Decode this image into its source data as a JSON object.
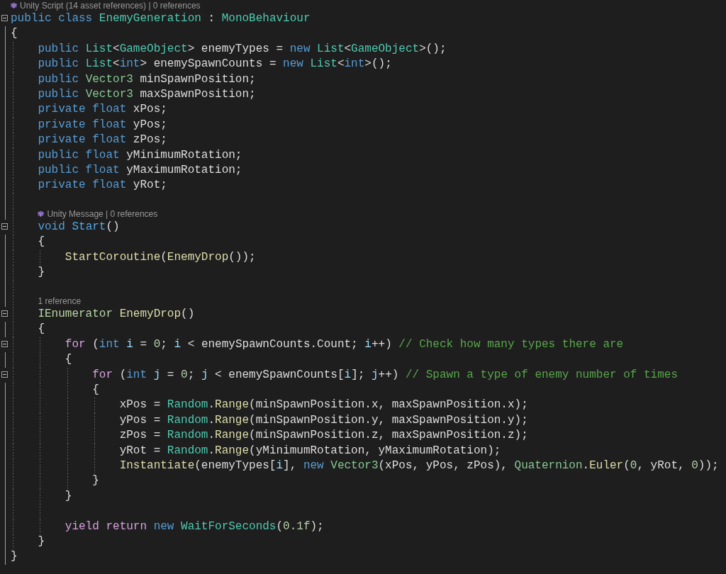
{
  "lines": [
    {
      "kind": "lens",
      "icon": true,
      "text": "Unity Script (14 asset references) | 0 references"
    },
    {
      "kind": "code",
      "fold": true,
      "tokens": [
        {
          "kind": "keyword",
          "text": "public class "
        },
        {
          "kind": "class",
          "text": "EnemyGeneration"
        },
        {
          "kind": "plain",
          "text": " : "
        },
        {
          "kind": "class",
          "text": "MonoBehaviour"
        }
      ]
    },
    {
      "kind": "code",
      "fold": false,
      "tokens": [
        {
          "kind": "plain",
          "text": "{"
        }
      ],
      "children": [
        {
          "kind": "code",
          "fold": false,
          "tokens": [
            {
              "kind": "keyword",
              "text": "public "
            },
            {
              "kind": "class",
              "text": "List"
            },
            {
              "kind": "plain",
              "text": "<"
            },
            {
              "kind": "class",
              "text": "GameObject"
            },
            {
              "kind": "plain",
              "text": "> enemyTypes = "
            },
            {
              "kind": "keyword",
              "text": "new "
            },
            {
              "kind": "class",
              "text": "List"
            },
            {
              "kind": "plain",
              "text": "<"
            },
            {
              "kind": "class",
              "text": "GameObject"
            },
            {
              "kind": "plain",
              "text": ">();"
            }
          ]
        },
        {
          "kind": "code",
          "fold": false,
          "tokens": [
            {
              "kind": "keyword",
              "text": "public "
            },
            {
              "kind": "class",
              "text": "List"
            },
            {
              "kind": "plain",
              "text": "<"
            },
            {
              "kind": "keyword",
              "text": "int"
            },
            {
              "kind": "plain",
              "text": "> enemySpawnCounts = "
            },
            {
              "kind": "keyword",
              "text": "new "
            },
            {
              "kind": "class",
              "text": "List"
            },
            {
              "kind": "plain",
              "text": "<"
            },
            {
              "kind": "keyword",
              "text": "int"
            },
            {
              "kind": "plain",
              "text": ">();"
            }
          ]
        },
        {
          "kind": "code",
          "fold": false,
          "tokens": [
            {
              "kind": "keyword",
              "text": "public "
            },
            {
              "kind": "struct",
              "text": "Vector3"
            },
            {
              "kind": "plain",
              "text": " minSpawnPosition;"
            }
          ]
        },
        {
          "kind": "code",
          "fold": false,
          "tokens": [
            {
              "kind": "keyword",
              "text": "public "
            },
            {
              "kind": "struct",
              "text": "Vector3"
            },
            {
              "kind": "plain",
              "text": " maxSpawnPosition;"
            }
          ]
        },
        {
          "kind": "code",
          "fold": false,
          "tokens": [
            {
              "kind": "keyword",
              "text": "private float "
            },
            {
              "kind": "plain",
              "text": "xPos;"
            }
          ]
        },
        {
          "kind": "code",
          "fold": false,
          "tokens": [
            {
              "kind": "keyword",
              "text": "private float "
            },
            {
              "kind": "plain",
              "text": "yPos;"
            }
          ]
        },
        {
          "kind": "code",
          "fold": false,
          "tokens": [
            {
              "kind": "keyword",
              "text": "private float "
            },
            {
              "kind": "plain",
              "text": "zPos;"
            }
          ]
        },
        {
          "kind": "code",
          "fold": false,
          "tokens": [
            {
              "kind": "keyword",
              "text": "public float "
            },
            {
              "kind": "plain",
              "text": "yMinimumRotation;"
            }
          ]
        },
        {
          "kind": "code",
          "fold": false,
          "tokens": [
            {
              "kind": "keyword",
              "text": "public float "
            },
            {
              "kind": "plain",
              "text": "yMaximumRotation;"
            }
          ]
        },
        {
          "kind": "code",
          "fold": false,
          "tokens": [
            {
              "kind": "keyword",
              "text": "private float "
            },
            {
              "kind": "plain",
              "text": "yRot;"
            }
          ]
        },
        {
          "kind": "blank"
        },
        {
          "kind": "lens",
          "icon": true,
          "text": "Unity Message | 0 references"
        },
        {
          "kind": "code",
          "fold": true,
          "tokens": [
            {
              "kind": "keyword",
              "text": "void "
            },
            {
              "kind": "message",
              "text": "Start"
            },
            {
              "kind": "plain",
              "text": "()"
            }
          ]
        },
        {
          "kind": "code",
          "fold": false,
          "tokens": [
            {
              "kind": "plain",
              "text": "{"
            }
          ],
          "children": [
            {
              "kind": "code",
              "fold": false,
              "tokens": [
                {
                  "kind": "method",
                  "text": "StartCoroutine"
                },
                {
                  "kind": "plain",
                  "text": "("
                },
                {
                  "kind": "method",
                  "text": "EnemyDrop"
                },
                {
                  "kind": "plain",
                  "text": "());"
                }
              ]
            }
          ]
        },
        {
          "kind": "code",
          "fold": false,
          "tokens": [
            {
              "kind": "plain",
              "text": "}"
            }
          ]
        },
        {
          "kind": "blank"
        },
        {
          "kind": "lens",
          "icon": false,
          "text": "1 reference"
        },
        {
          "kind": "code",
          "fold": true,
          "tokens": [
            {
              "kind": "interface",
              "text": "IEnumerator "
            },
            {
              "kind": "method",
              "text": "EnemyDrop"
            },
            {
              "kind": "plain",
              "text": "()"
            }
          ]
        },
        {
          "kind": "code",
          "fold": false,
          "tokens": [
            {
              "kind": "plain",
              "text": "{"
            }
          ],
          "children": [
            {
              "kind": "code",
              "fold": true,
              "tokens": [
                {
                  "kind": "control",
                  "text": "for"
                },
                {
                  "kind": "plain",
                  "text": " ("
                },
                {
                  "kind": "keyword",
                  "text": "int "
                },
                {
                  "kind": "local",
                  "text": "i"
                },
                {
                  "kind": "plain",
                  "text": " = "
                },
                {
                  "kind": "number",
                  "text": "0"
                },
                {
                  "kind": "plain",
                  "text": "; "
                },
                {
                  "kind": "local",
                  "text": "i"
                },
                {
                  "kind": "plain",
                  "text": " < enemySpawnCounts.Count; "
                },
                {
                  "kind": "local",
                  "text": "i"
                },
                {
                  "kind": "plain",
                  "text": "++) "
                },
                {
                  "kind": "comment",
                  "text": "// Check how many types there are"
                }
              ]
            },
            {
              "kind": "code",
              "fold": false,
              "tokens": [
                {
                  "kind": "plain",
                  "text": "{"
                }
              ],
              "children": [
                {
                  "kind": "code",
                  "fold": true,
                  "tokens": [
                    {
                      "kind": "control",
                      "text": "for"
                    },
                    {
                      "kind": "plain",
                      "text": " ("
                    },
                    {
                      "kind": "keyword",
                      "text": "int "
                    },
                    {
                      "kind": "local",
                      "text": "j"
                    },
                    {
                      "kind": "plain",
                      "text": " = "
                    },
                    {
                      "kind": "number",
                      "text": "0"
                    },
                    {
                      "kind": "plain",
                      "text": "; "
                    },
                    {
                      "kind": "local",
                      "text": "j"
                    },
                    {
                      "kind": "plain",
                      "text": " < enemySpawnCounts["
                    },
                    {
                      "kind": "local",
                      "text": "i"
                    },
                    {
                      "kind": "plain",
                      "text": "]; "
                    },
                    {
                      "kind": "local",
                      "text": "j"
                    },
                    {
                      "kind": "plain",
                      "text": "++) "
                    },
                    {
                      "kind": "comment",
                      "text": "// Spawn a type of enemy number of times"
                    }
                  ]
                },
                {
                  "kind": "code",
                  "fold": false,
                  "tokens": [
                    {
                      "kind": "plain",
                      "text": "{"
                    }
                  ],
                  "children": [
                    {
                      "kind": "code",
                      "fold": false,
                      "tokens": [
                        {
                          "kind": "plain",
                          "text": "xPos = "
                        },
                        {
                          "kind": "class",
                          "text": "Random"
                        },
                        {
                          "kind": "plain",
                          "text": "."
                        },
                        {
                          "kind": "method",
                          "text": "Range"
                        },
                        {
                          "kind": "plain",
                          "text": "(minSpawnPosition.x, maxSpawnPosition.x);"
                        }
                      ]
                    },
                    {
                      "kind": "code",
                      "fold": false,
                      "tokens": [
                        {
                          "kind": "plain",
                          "text": "yPos = "
                        },
                        {
                          "kind": "class",
                          "text": "Random"
                        },
                        {
                          "kind": "plain",
                          "text": "."
                        },
                        {
                          "kind": "method",
                          "text": "Range"
                        },
                        {
                          "kind": "plain",
                          "text": "(minSpawnPosition.y, maxSpawnPosition.y);"
                        }
                      ]
                    },
                    {
                      "kind": "code",
                      "fold": false,
                      "tokens": [
                        {
                          "kind": "plain",
                          "text": "zPos = "
                        },
                        {
                          "kind": "class",
                          "text": "Random"
                        },
                        {
                          "kind": "plain",
                          "text": "."
                        },
                        {
                          "kind": "method",
                          "text": "Range"
                        },
                        {
                          "kind": "plain",
                          "text": "(minSpawnPosition.z, maxSpawnPosition.z);"
                        }
                      ]
                    },
                    {
                      "kind": "code",
                      "fold": false,
                      "tokens": [
                        {
                          "kind": "plain",
                          "text": "yRot = "
                        },
                        {
                          "kind": "class",
                          "text": "Random"
                        },
                        {
                          "kind": "plain",
                          "text": "."
                        },
                        {
                          "kind": "method",
                          "text": "Range"
                        },
                        {
                          "kind": "plain",
                          "text": "(yMinimumRotation, yMaximumRotation);"
                        }
                      ]
                    },
                    {
                      "kind": "code",
                      "fold": false,
                      "tokens": [
                        {
                          "kind": "method",
                          "text": "Instantiate"
                        },
                        {
                          "kind": "plain",
                          "text": "(enemyTypes["
                        },
                        {
                          "kind": "local",
                          "text": "i"
                        },
                        {
                          "kind": "plain",
                          "text": "], "
                        },
                        {
                          "kind": "keyword",
                          "text": "new "
                        },
                        {
                          "kind": "struct",
                          "text": "Vector3"
                        },
                        {
                          "kind": "plain",
                          "text": "(xPos, yPos, zPos), "
                        },
                        {
                          "kind": "struct",
                          "text": "Quaternion"
                        },
                        {
                          "kind": "plain",
                          "text": "."
                        },
                        {
                          "kind": "method",
                          "text": "Euler"
                        },
                        {
                          "kind": "plain",
                          "text": "("
                        },
                        {
                          "kind": "number",
                          "text": "0"
                        },
                        {
                          "kind": "plain",
                          "text": ", yRot, "
                        },
                        {
                          "kind": "number",
                          "text": "0"
                        },
                        {
                          "kind": "plain",
                          "text": "));"
                        }
                      ]
                    }
                  ]
                },
                {
                  "kind": "code",
                  "fold": false,
                  "tokens": [
                    {
                      "kind": "plain",
                      "text": "}"
                    }
                  ]
                }
              ]
            },
            {
              "kind": "code",
              "fold": false,
              "tokens": [
                {
                  "kind": "plain",
                  "text": "}"
                }
              ]
            },
            {
              "kind": "blank"
            },
            {
              "kind": "code",
              "fold": false,
              "tokens": [
                {
                  "kind": "control",
                  "text": "yield return "
                },
                {
                  "kind": "keyword",
                  "text": "new "
                },
                {
                  "kind": "class",
                  "text": "WaitForSeconds"
                },
                {
                  "kind": "plain",
                  "text": "("
                },
                {
                  "kind": "number",
                  "text": "0.1f"
                },
                {
                  "kind": "plain",
                  "text": ");"
                }
              ]
            }
          ]
        },
        {
          "kind": "code",
          "fold": false,
          "tokens": [
            {
              "kind": "plain",
              "text": "}"
            }
          ]
        }
      ]
    },
    {
      "kind": "code",
      "fold": false,
      "tokens": [
        {
          "kind": "plain",
          "text": "}"
        }
      ]
    }
  ]
}
